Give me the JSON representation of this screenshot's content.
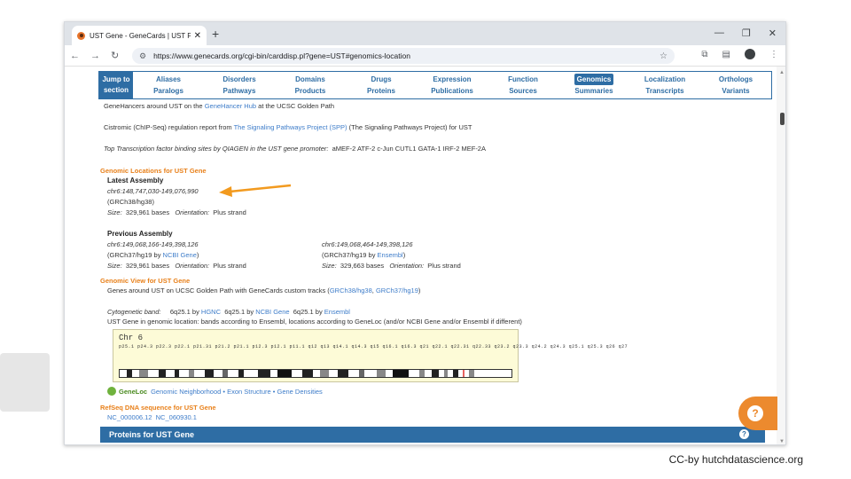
{
  "browser": {
    "tab_title": "UST Gene - GeneCards | UST Pr",
    "url": "https://www.genecards.org/cgi-bin/carddisp.pl?gene=UST#genomics-location"
  },
  "jump_nav": {
    "jump_label_1": "Jump to",
    "jump_label_2": "section",
    "items": [
      {
        "top": "Aliases",
        "bottom": "Paralogs"
      },
      {
        "top": "Disorders",
        "bottom": "Pathways"
      },
      {
        "top": "Domains",
        "bottom": "Products"
      },
      {
        "top": "Drugs",
        "bottom": "Proteins"
      },
      {
        "top": "Expression",
        "bottom": "Publications"
      },
      {
        "top": "Function",
        "bottom": "Sources"
      },
      {
        "top": "Genomics",
        "bottom": "Summaries"
      },
      {
        "top": "Localization",
        "bottom": "Transcripts"
      },
      {
        "top": "Orthologs",
        "bottom": "Variants"
      }
    ]
  },
  "content": {
    "genehancer_pre": "GeneHancers around UST on the ",
    "genehancer_link": "GeneHancer Hub",
    "genehancer_post": " at the UCSC Golden Path",
    "cistromic_pre": "Cistromic (ChIP-Seq) regulation report from ",
    "cistromic_link": "The Signaling Pathways Project (SPP)",
    "cistromic_post": " (The Signaling Pathways Project) for UST",
    "tfbs_label": "Top Transcription factor binding sites by QIAGEN in the UST gene promoter:",
    "tfbs_values": "aMEF-2  ATF-2  c-Jun  CUTL1  GATA-1  IRF-2  MEF-2A",
    "genomic_locations_heading": "Genomic Locations for UST Gene",
    "latest_assembly_label": "Latest Assembly",
    "latest_coords": "chr6:148,747,030-149,076,990",
    "latest_build": "(GRCh38/hg38)",
    "latest_size_label": "Size:",
    "latest_size": "329,961 bases",
    "orientation_label": "Orientation:",
    "latest_orientation": "Plus strand",
    "previous_assembly_label": "Previous Assembly",
    "prev1_coords": "chr6:149,068,166-149,398,126",
    "prev1_build_pre": "(GRCh37/hg19 by ",
    "prev1_build_link": "NCBI Gene",
    "prev1_build_post": ")",
    "prev1_size": "329,961 bases",
    "prev1_orientation": "Plus strand",
    "prev2_coords": "chr6:149,068,464-149,398,126",
    "prev2_build_pre": "(GRCh37/hg19 by ",
    "prev2_build_link": "Ensembl",
    "prev2_build_post": ")",
    "prev2_size": "329,663 bases",
    "prev2_orientation": "Plus strand",
    "genomic_view_heading": "Genomic View for UST Gene",
    "genomic_view_pre": "Genes around UST on UCSC Golden Path with GeneCards custom tracks (",
    "genomic_view_link1": "GRCh38/hg38",
    "genomic_view_sep": ", ",
    "genomic_view_link2": "GRCh37/hg19",
    "genomic_view_post": ")",
    "cytogenetic_label": "Cytogenetic band:",
    "cyto_1": "6q25.1 by ",
    "cyto_1_link": "HGNC",
    "cyto_2": "6q25.1 by ",
    "cyto_2_link": "NCBI Gene",
    "cyto_3": "6q25.1 by ",
    "cyto_3_link": "Ensembl",
    "genomic_location_note": "UST Gene in genomic location: bands according to Ensembl, locations according to GeneLoc (and/or NCBI Gene and/or Ensembl if different)",
    "chr_label": "Chr 6",
    "band_labels": "p25.1 p24.3  p22.3  p22.1 p21.31 p21.2 p21.1  p12.3  p12.1  p11.1  q12  q13  q14.1  q14.3  q15  q16.1  q16.3  q21  q22.1 q22.31 q22.33 q23.2 q23.3 q24.2 q24.3 q25.1 q25.3 q26 q27",
    "geneloc_logo": "GeneLoc",
    "geneloc_links": "Genomic Neighborhood • Exon Structure • Gene Densities",
    "refseq_heading": "RefSeq DNA sequence for UST Gene",
    "refseq_1": "NC_000006.12",
    "refseq_2": "NC_060930.1"
  },
  "proteins_header": "Proteins for UST Gene",
  "help_icon_text": "?",
  "credit": "CC-by hutchdatascience.org",
  "colors": {
    "genecards_blue": "#2e6da4",
    "heading_orange": "#e8801a",
    "arrow_orange": "#f29a1f",
    "help_orange": "#ec8a2e"
  }
}
